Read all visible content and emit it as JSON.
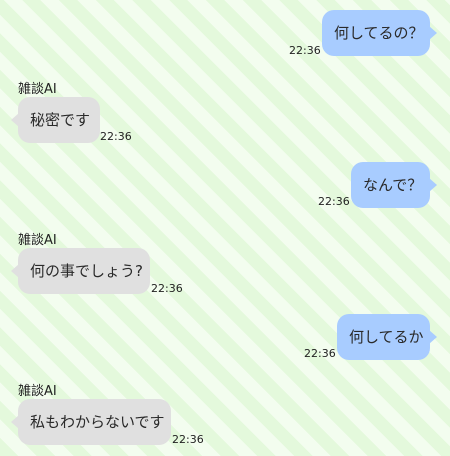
{
  "messages": [
    {
      "role": "user",
      "text": "何してるの？",
      "time": "22:36"
    },
    {
      "role": "bot",
      "sender": "雑談AI",
      "text": "秘密です",
      "time": "22:36"
    },
    {
      "role": "user",
      "text": "なんで？",
      "time": "22:36"
    },
    {
      "role": "bot",
      "sender": "雑談AI",
      "text": "何の事でしょう?",
      "time": "22:36"
    },
    {
      "role": "user",
      "text": "何してるか",
      "time": "22:36"
    },
    {
      "role": "bot",
      "sender": "雑談AI",
      "text": "私もわからないです",
      "time": "22:36"
    }
  ],
  "colors": {
    "user_bubble": "#a8ccff",
    "bot_bubble": "#e0e0e0",
    "background_a": "#e4f9dc",
    "background_b": "#f3fdef"
  }
}
